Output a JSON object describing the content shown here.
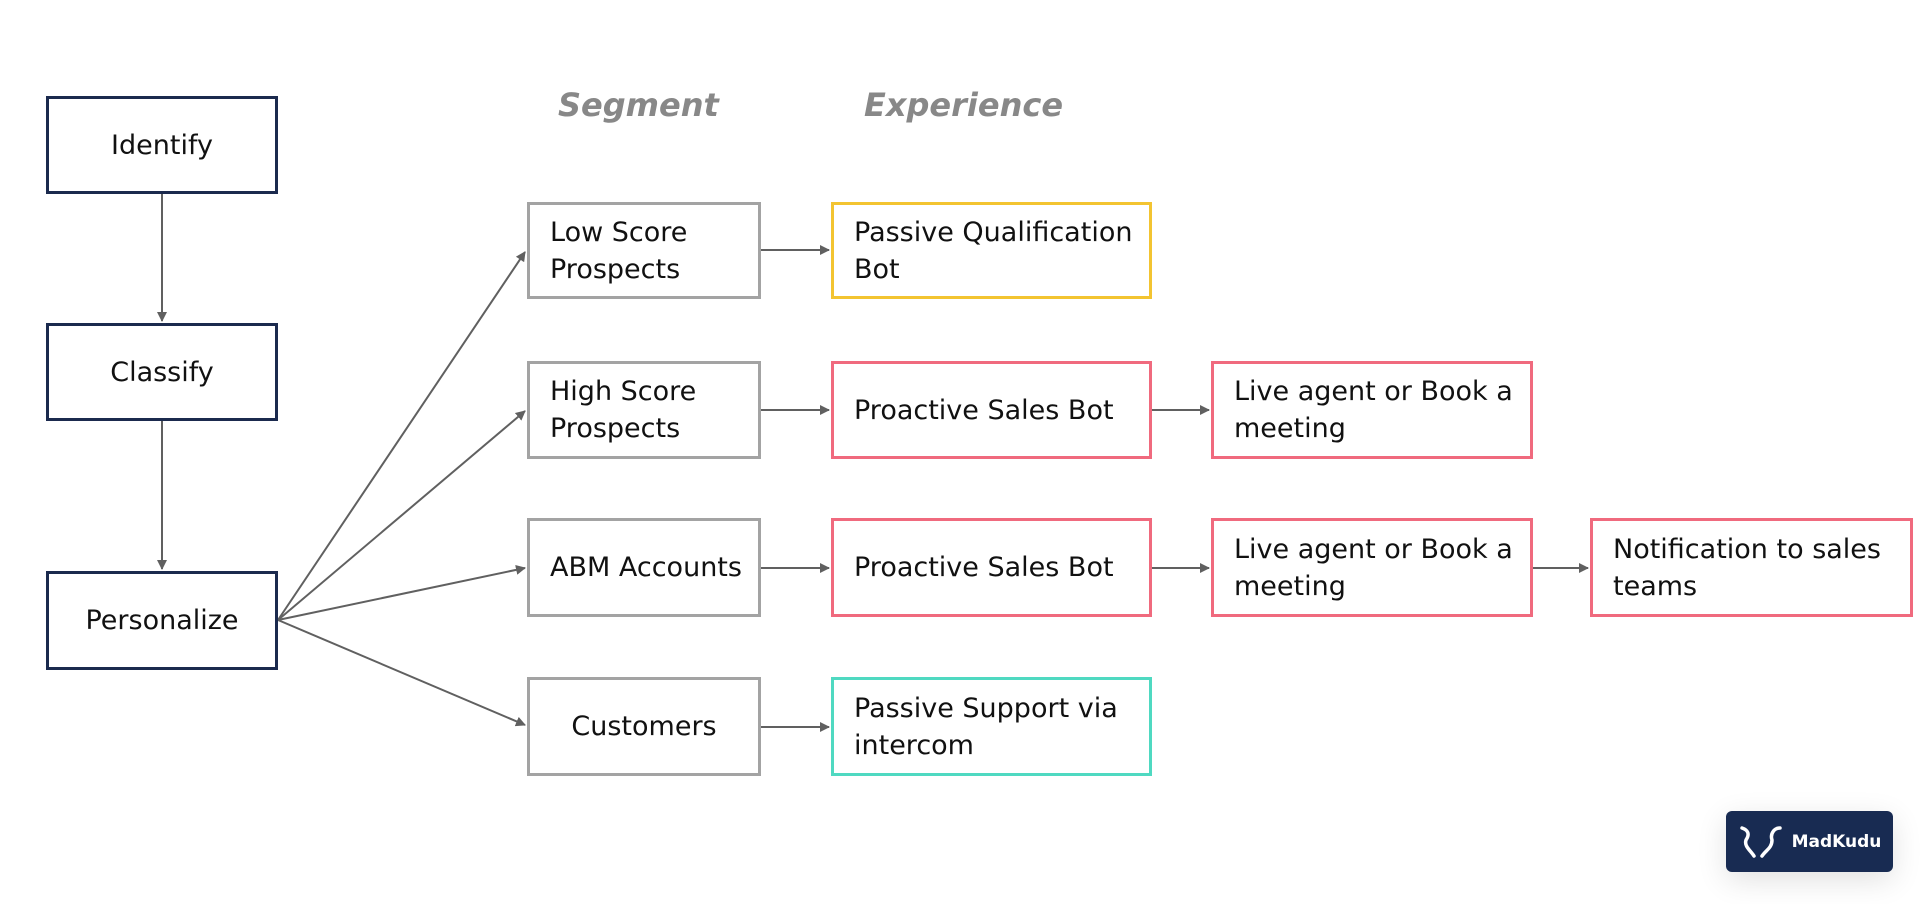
{
  "headers": {
    "segment": "Segment",
    "experience": "Experience"
  },
  "steps": [
    "Identify",
    "Classify",
    "Personalize"
  ],
  "rows": [
    {
      "segment": "Low Score Prospects",
      "experience": [
        "Passive Qualification Bot"
      ],
      "color": "#f3c431"
    },
    {
      "segment": "High Score Prospects",
      "experience": [
        "Proactive Sales Bot",
        "Live agent or Book a meeting"
      ],
      "color": "#f06a7e"
    },
    {
      "segment": "ABM Accounts",
      "experience": [
        "Proactive Sales Bot",
        "Live agent or Book a meeting",
        "Notification to sales teams"
      ],
      "color": "#f06a7e"
    },
    {
      "segment": "Customers",
      "experience": [
        "Passive Support via intercom"
      ],
      "color": "#4fd9c1"
    }
  ],
  "logo": {
    "text": "MadKudu"
  }
}
